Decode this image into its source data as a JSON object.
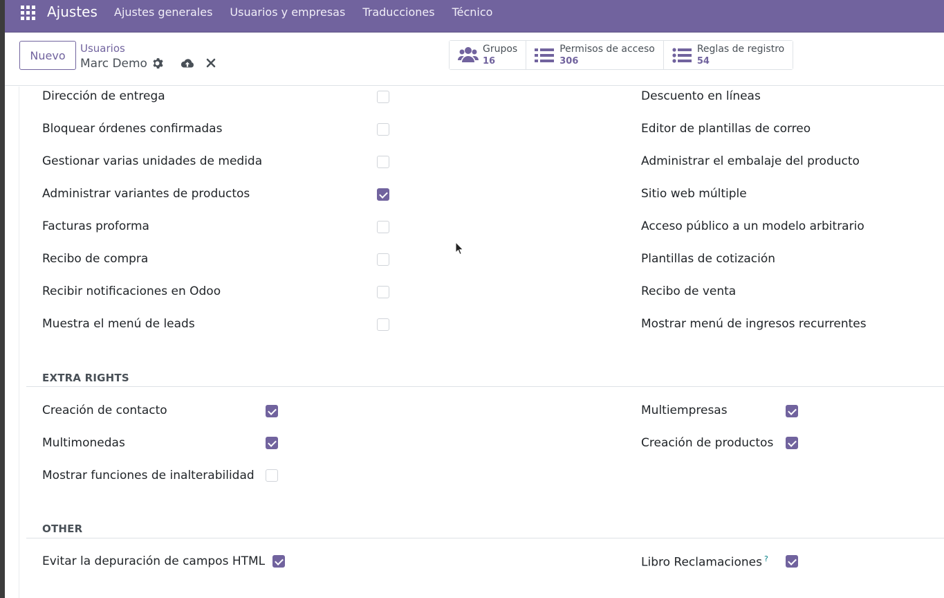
{
  "navbar": {
    "brand": "Ajustes",
    "menu": [
      "Ajustes generales",
      "Usuarios y empresas",
      "Traducciones",
      "Técnico"
    ]
  },
  "control_panel": {
    "new_button": "Nuevo",
    "breadcrumb": "Usuarios",
    "record_name": "Marc Demo",
    "smart_buttons": [
      {
        "label": "Grupos",
        "count": "16",
        "icon": "users-icon"
      },
      {
        "label": "Permisos de acceso",
        "count": "306",
        "icon": "list-icon"
      },
      {
        "label": "Reglas de registro",
        "count": "54",
        "icon": "list-icon"
      }
    ]
  },
  "top_left_items": [
    {
      "label": "Dirección de entrega",
      "checked": false
    },
    {
      "label": "Bloquear órdenes confirmadas",
      "checked": false
    },
    {
      "label": "Gestionar varias unidades de medida",
      "checked": false
    },
    {
      "label": "Administrar variantes de productos",
      "checked": true
    },
    {
      "label": "Facturas proforma",
      "checked": false
    },
    {
      "label": "Recibo de compra",
      "checked": false
    },
    {
      "label": "Recibir notificaciones en Odoo",
      "checked": false
    },
    {
      "label": "Muestra el menú de leads",
      "checked": false
    }
  ],
  "top_right_items": [
    "Descuento en líneas",
    "Editor de plantillas de correo",
    "Administrar el embalaje del producto",
    "Sitio web múltiple",
    "Acceso público a un modelo arbitrario",
    "Plantillas de cotización",
    "Recibo de venta",
    "Mostrar menú de ingresos recurrentes"
  ],
  "extra_rights": {
    "title": "EXTRA RIGHTS",
    "left": [
      {
        "label": "Creación de contacto",
        "checked": true
      },
      {
        "label": "Multimonedas",
        "checked": true
      },
      {
        "label": "Mostrar funciones de inalterabilidad",
        "checked": false
      }
    ],
    "right": [
      {
        "label": "Multiempresas",
        "checked": true
      },
      {
        "label": "Creación de productos",
        "checked": true
      }
    ]
  },
  "other": {
    "title": "OTHER",
    "left": [
      {
        "label": "Evitar la depuración de campos HTML",
        "checked": true
      }
    ],
    "right": [
      {
        "label": "Libro Reclamaciones",
        "help": "?",
        "checked": true
      }
    ]
  },
  "colors": {
    "primary": "#71639e",
    "navbar": "#71639e"
  }
}
